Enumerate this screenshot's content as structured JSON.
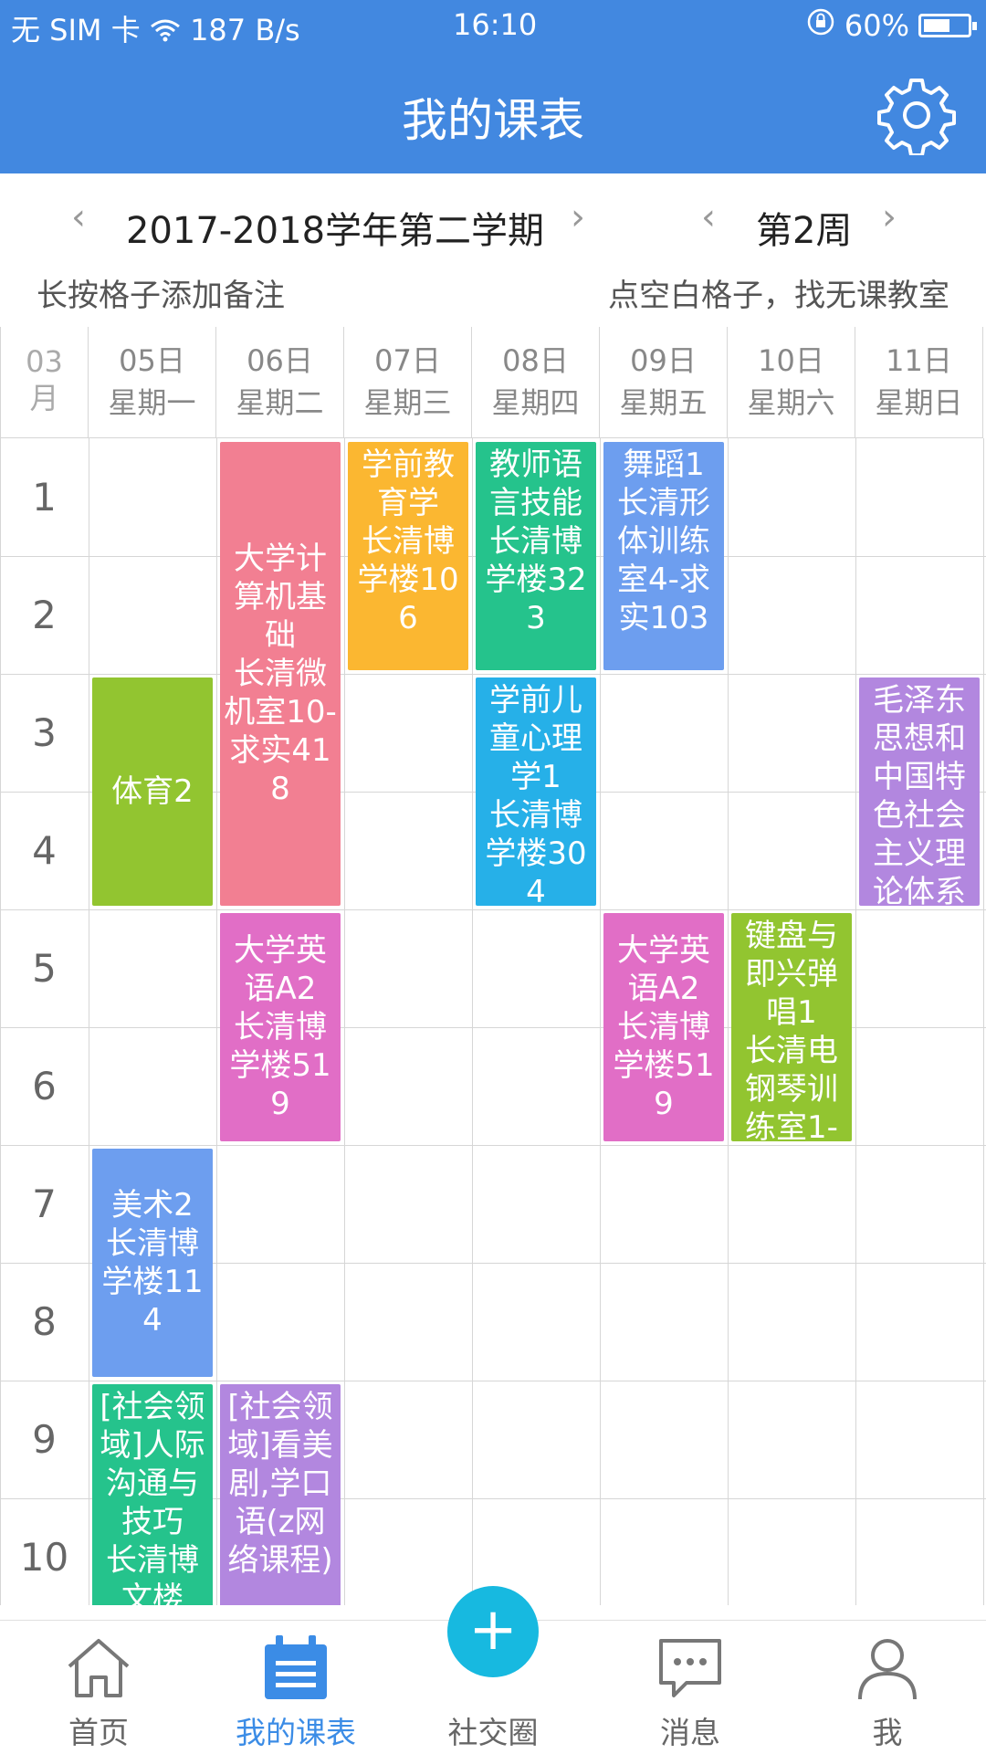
{
  "status_bar": {
    "carrier": "无 SIM 卡",
    "speed": "187 B/s",
    "time": "16:10",
    "battery": "60%",
    "battery_level": 0.6
  },
  "header": {
    "title": "我的课表",
    "settings_icon": "gear-icon"
  },
  "term": {
    "label": "2017-2018学年第二学期",
    "week": "第2周",
    "prev": "‹",
    "next": "›"
  },
  "hints": {
    "left": "长按格子添加备注",
    "right": "点空白格子，找无课教室"
  },
  "table": {
    "month": "03\n月",
    "days": [
      {
        "date": "05日",
        "weekday": "星期一"
      },
      {
        "date": "06日",
        "weekday": "星期二"
      },
      {
        "date": "07日",
        "weekday": "星期三"
      },
      {
        "date": "08日",
        "weekday": "星期四"
      },
      {
        "date": "09日",
        "weekday": "星期五"
      },
      {
        "date": "10日",
        "weekday": "星期六"
      },
      {
        "date": "11日",
        "weekday": "星期日"
      }
    ],
    "periods": [
      "1",
      "2",
      "3",
      "4",
      "5",
      "6",
      "7",
      "8",
      "9",
      "10"
    ],
    "courses": [
      {
        "day": 2,
        "start": 1,
        "end": 2,
        "text": "学前教育学\n长清博学楼106",
        "color": "#fbb731"
      },
      {
        "day": 3,
        "start": 1,
        "end": 2,
        "text": "教师语言技能\n长清博学楼323",
        "color": "#25c38c"
      },
      {
        "day": 4,
        "start": 1,
        "end": 2,
        "text": "舞蹈1\n长清形体训练室4-求实103",
        "color": "#6d9eef"
      },
      {
        "day": 1,
        "start": 1,
        "end": 4,
        "text": "大学计算机基础\n长清微机室10-求实418",
        "color": "#f27f92",
        "center": true
      },
      {
        "day": 0,
        "start": 3,
        "end": 4,
        "text": "体育2",
        "color": "#92c530",
        "center": true
      },
      {
        "day": 3,
        "start": 3,
        "end": 4,
        "text": "学前儿童心理学1\n长清博学楼304",
        "color": "#26b0e8"
      },
      {
        "day": 6,
        "start": 3,
        "end": 4,
        "text": "毛泽东思想和中国特色社会主义理论体系",
        "color": "#b287df"
      },
      {
        "day": 1,
        "start": 5,
        "end": 6,
        "text": "大学英语A2\n长清博学楼519",
        "color": "#e16ec6",
        "center": true
      },
      {
        "day": 4,
        "start": 5,
        "end": 6,
        "text": "大学英语A2\n长清博学楼519",
        "color": "#e16ec6",
        "center": true
      },
      {
        "day": 5,
        "start": 5,
        "end": 6,
        "text": "键盘与即兴弹唱1\n长清电钢琴训练室1-",
        "color": "#92c530"
      },
      {
        "day": 0,
        "start": 7,
        "end": 8,
        "text": "美术2\n长清博学楼114",
        "color": "#6d9eef",
        "center": true
      },
      {
        "day": 0,
        "start": 9,
        "end": 10,
        "text": "[社会领域]人际沟通与技巧\n长清博文楼",
        "color": "#25c38c"
      },
      {
        "day": 1,
        "start": 9,
        "end": 10,
        "text": "[社会领域]看美剧,学口语(z网络课程)",
        "color": "#b287df"
      }
    ]
  },
  "bottom_nav": [
    {
      "label": "首页",
      "icon": "home-icon"
    },
    {
      "label": "我的课表",
      "icon": "schedule-icon",
      "active": true
    },
    {
      "label": "社交圈",
      "icon": "plus-icon"
    },
    {
      "label": "消息",
      "icon": "message-icon"
    },
    {
      "label": "我",
      "icon": "user-icon"
    }
  ],
  "colors": {
    "primary": "#4288e0",
    "active": "#3b8ce6",
    "fab": "#17b9e0"
  }
}
